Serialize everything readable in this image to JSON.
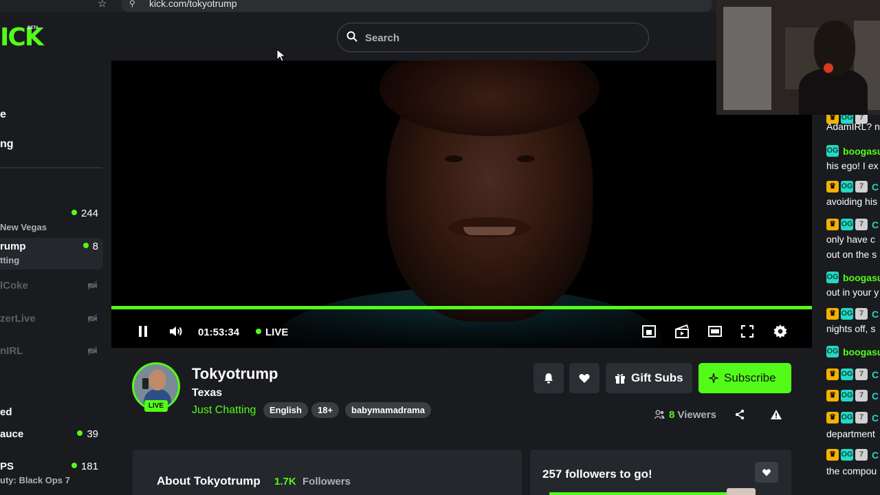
{
  "browser": {
    "url": "kick.com/tokyotrump"
  },
  "header": {
    "logo": "ICK",
    "beta": "BETA",
    "search_placeholder": "Search"
  },
  "sidebar": {
    "nav": [
      "e",
      "ng"
    ],
    "channels": [
      {
        "name": "",
        "category": "New Vegas",
        "viewers": "244",
        "online": true
      },
      {
        "name": "rump",
        "category": "tting",
        "viewers": "8",
        "online": true,
        "active": true
      },
      {
        "name": "lCoke",
        "online": false
      },
      {
        "name": "zerLive",
        "online": false
      },
      {
        "name": "nIRL",
        "online": false
      }
    ],
    "section": "ed",
    "channels2": [
      {
        "name": "auce",
        "category": "",
        "viewers": "39"
      },
      {
        "name": "PS",
        "category": "uty: Black Ops 7",
        "viewers": "181"
      }
    ]
  },
  "player": {
    "time": "01:53:34",
    "live": "LIVE",
    "progress": 1.0
  },
  "streamer": {
    "name": "Tokyotrump",
    "location": "Texas",
    "category": "Just Chatting",
    "live_tag": "LIVE",
    "tags": [
      "English",
      "18+",
      "babymamadrama"
    ],
    "gift_label": "Gift Subs",
    "subscribe_label": "Subscribe",
    "viewers_num": "8",
    "viewers_label": "Viewers"
  },
  "about": {
    "title": "About Tokyotrump",
    "followers_num": "1.7K",
    "followers_label": "Followers"
  },
  "goal": {
    "title": "257 followers to go!"
  },
  "chat": [
    {
      "badges": [
        "crown",
        "og",
        "sub"
      ],
      "user": "",
      "text": "AdamIRL? n"
    },
    {
      "badges": [
        "og"
      ],
      "user": "boogasu",
      "text": "his ego! I ex"
    },
    {
      "badges": [
        "crown",
        "og",
        "sub"
      ],
      "user": "C",
      "text": "avoiding his"
    },
    {
      "badges": [
        "crown",
        "og",
        "sub"
      ],
      "user": "C",
      "text": "only have c",
      "text2": "out on the s"
    },
    {
      "badges": [
        "og"
      ],
      "user": "boogasu",
      "text": "out in your y"
    },
    {
      "badges": [
        "crown",
        "og",
        "sub"
      ],
      "user": "C",
      "text": "nights off, s"
    },
    {
      "badges": [
        "og"
      ],
      "user": "boogasu",
      "text": ""
    },
    {
      "badges": [
        "crown",
        "og",
        "sub"
      ],
      "user": "C",
      "text": ""
    },
    {
      "badges": [
        "crown",
        "og",
        "sub"
      ],
      "user": "C",
      "text": ""
    },
    {
      "badges": [
        "crown",
        "og",
        "sub"
      ],
      "user": "C",
      "text": "department"
    },
    {
      "badges": [
        "crown",
        "og",
        "sub"
      ],
      "user": "C",
      "text": "the compou"
    }
  ],
  "colors": {
    "brand": "#53fc18",
    "background": "#191b1f",
    "surface": "#24272c",
    "og_badge": "#25d8c4",
    "crown_badge": "#f5b100"
  }
}
